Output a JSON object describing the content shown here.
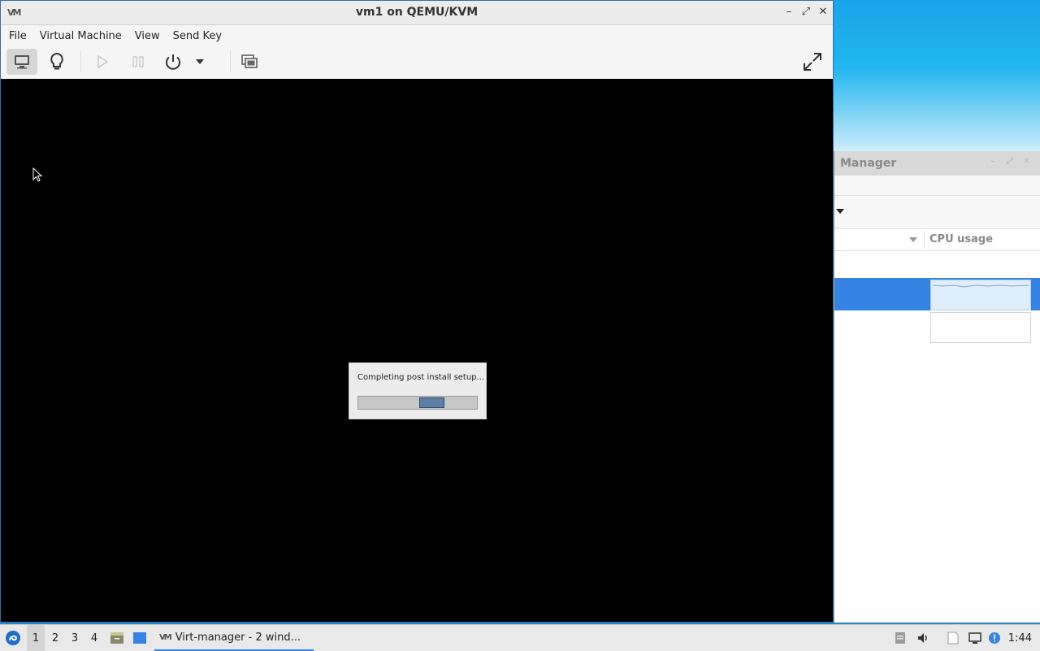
{
  "vm_window": {
    "title": "vm1 on QEMU/KVM",
    "app_icon": "virt-manager-icon",
    "controls": {
      "minimize": "–",
      "maximize": "⤢",
      "close": "✕"
    },
    "menu": [
      "File",
      "Virtual Machine",
      "View",
      "Send Key"
    ],
    "toolbar": {
      "console_icon": "monitor-icon",
      "details_icon": "lightbulb-icon",
      "run_icon": "play-icon",
      "pause_icon": "pause-icon",
      "shutdown_icon": "power-icon",
      "shutdown_menu_icon": "chevron-down-icon",
      "snapshots_icon": "snapshots-icon",
      "fullscreen_icon": "fullscreen-icon"
    },
    "console": {
      "dialog_message": "Completing post install setup...",
      "progress_fraction": 0.62,
      "progress_fill_width_fraction": 0.21
    }
  },
  "manager_window": {
    "title": "Manager",
    "column_header": "CPU usage"
  },
  "taskbar": {
    "workspaces": [
      "1",
      "2",
      "3",
      "4"
    ],
    "task_label": "Virt-manager - 2 wind...",
    "clock": "1:44"
  },
  "colors": {
    "accent": "#3584e4",
    "progress_fill": "#5e7ea3"
  }
}
